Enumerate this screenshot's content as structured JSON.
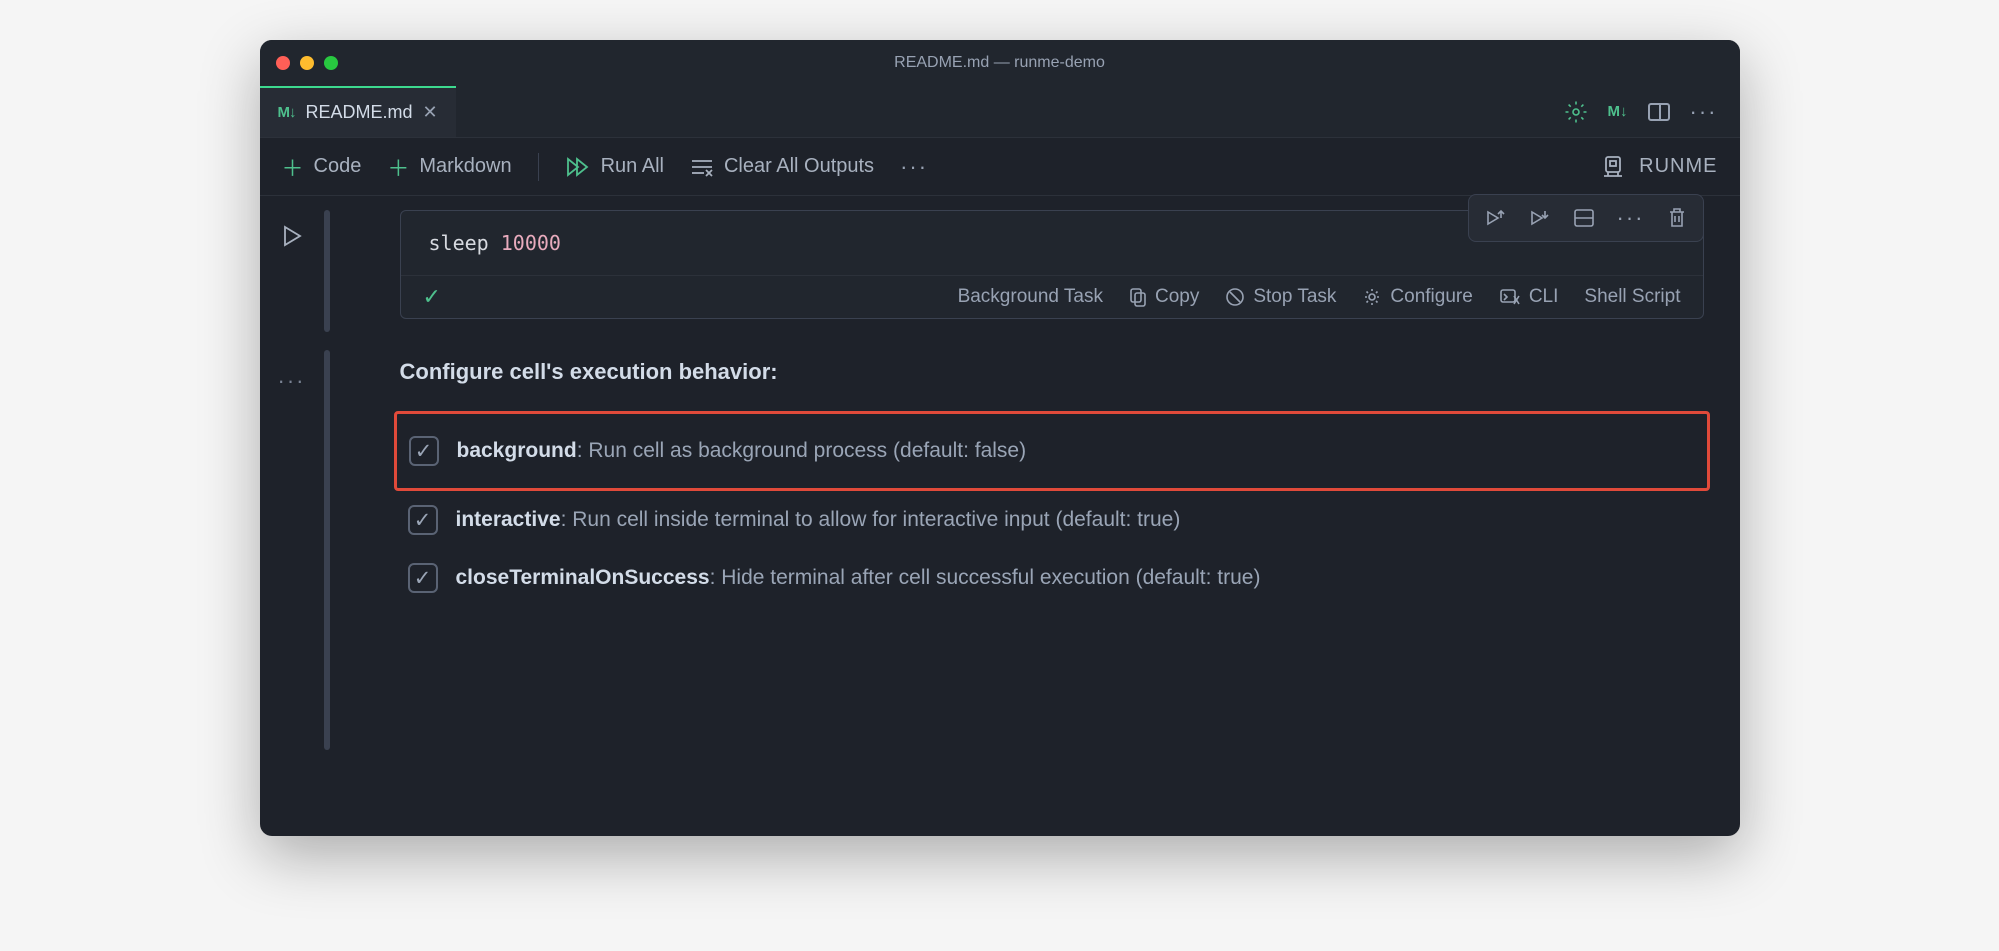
{
  "window": {
    "title": "README.md — runme-demo"
  },
  "tab": {
    "icon": "M↓",
    "name": "README.md"
  },
  "editor_actions": {
    "md_badge": "M↓"
  },
  "toolbar": {
    "code": "Code",
    "markdown": "Markdown",
    "run_all": "Run All",
    "clear_outputs": "Clear All Outputs"
  },
  "kernel": {
    "name": "RUNME"
  },
  "cell": {
    "code_command": "sleep",
    "code_arg": "10000",
    "footer": {
      "background_task": "Background Task",
      "copy": "Copy",
      "stop_task": "Stop Task",
      "configure": "Configure",
      "cli": "CLI",
      "shell_script": "Shell Script"
    }
  },
  "config": {
    "title": "Configure cell's execution behavior:",
    "items": [
      {
        "name": "background",
        "desc": ": Run cell as background process (default: false)",
        "checked": true,
        "highlighted": true
      },
      {
        "name": "interactive",
        "desc": ": Run cell inside terminal to allow for interactive input (default: true)",
        "checked": true,
        "highlighted": false
      },
      {
        "name": "closeTerminalOnSuccess",
        "desc": ": Hide terminal after cell successful execution (default: true)",
        "checked": true,
        "highlighted": false
      }
    ]
  }
}
